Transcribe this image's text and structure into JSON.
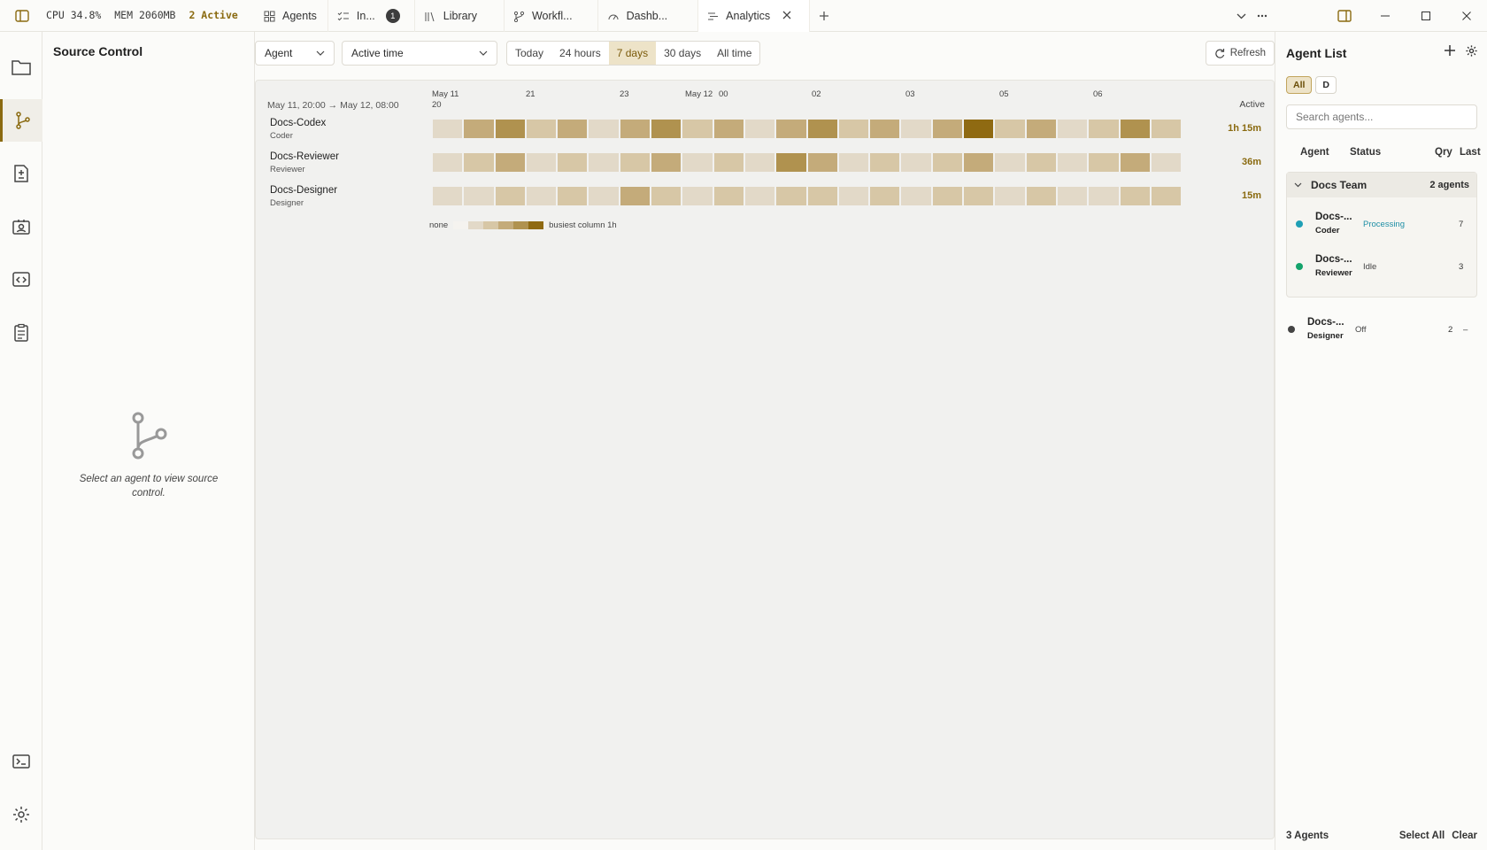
{
  "topbar": {
    "cpu": "CPU 34.8%",
    "mem": "MEM 2060MB",
    "active": "2 Active",
    "tabs": [
      {
        "label": "Agents",
        "icon": "grid-icon"
      },
      {
        "label": "In...",
        "icon": "checklist-icon",
        "badge": "1"
      },
      {
        "label": "Library",
        "icon": "library-icon"
      },
      {
        "label": "Workfl...",
        "icon": "workflow-icon"
      },
      {
        "label": "Dashb...",
        "icon": "gauge-icon"
      },
      {
        "label": "Analytics",
        "icon": "analytics-icon",
        "selected": true
      }
    ]
  },
  "source_control": {
    "title": "Source Control",
    "empty_text": "Select an agent to view source control."
  },
  "filters": {
    "group_by": "Agent",
    "metric": "Active time",
    "ranges": [
      "Today",
      "24 hours",
      "7 days",
      "30 days",
      "All time"
    ],
    "selected_range": "7 days",
    "refresh": "Refresh"
  },
  "heatmap": {
    "range_label": "May 11, 20:00 → May 12, 08:00",
    "date_labels": [
      "May 11",
      "May 12"
    ],
    "hour_labels": [
      "20",
      "21",
      "23",
      "00",
      "02",
      "03",
      "05",
      "06"
    ],
    "active_header": "Active",
    "agents": [
      {
        "name": "Docs-Codex",
        "role": "Coder",
        "active": "1h 15m",
        "levels": [
          1,
          3,
          4,
          2,
          3,
          1,
          3,
          4,
          2,
          3,
          1,
          3,
          4,
          2,
          3,
          1,
          3,
          5,
          2,
          3,
          1,
          2,
          4,
          2
        ]
      },
      {
        "name": "Docs-Reviewer",
        "role": "Reviewer",
        "active": "36m",
        "levels": [
          1,
          2,
          3,
          1,
          2,
          1,
          2,
          3,
          1,
          2,
          1,
          4,
          3,
          1,
          2,
          1,
          2,
          3,
          1,
          2,
          1,
          2,
          3,
          1
        ]
      },
      {
        "name": "Docs-Designer",
        "role": "Designer",
        "active": "15m",
        "levels": [
          1,
          1,
          2,
          1,
          2,
          1,
          3,
          2,
          1,
          2,
          1,
          2,
          2,
          1,
          2,
          1,
          2,
          2,
          1,
          2,
          1,
          1,
          2,
          2
        ]
      }
    ],
    "legend": {
      "none": "none",
      "busiest": "busiest column 1h"
    },
    "colors": [
      "#f5f3ef",
      "#e2d9c8",
      "#d7c7a6",
      "#c4ab7a",
      "#b0924f",
      "#8f6a12"
    ]
  },
  "agent_list": {
    "title": "Agent List",
    "filter_chips": [
      "All",
      "D"
    ],
    "search_placeholder": "Search agents...",
    "columns": {
      "agent": "Agent",
      "status": "Status",
      "qry": "Qry",
      "last": "Last"
    },
    "group": {
      "name": "Docs Team",
      "count": "2 agents"
    },
    "agents": [
      {
        "name": "Docs-...",
        "role": "Coder",
        "status": "Processing",
        "status_color": "#1f8fa6",
        "dot_color": "#1f9fb5",
        "qry": "7",
        "last": ""
      },
      {
        "name": "Docs-...",
        "role": "Reviewer",
        "status": "Idle",
        "status_color": "#444444",
        "dot_color": "#14a36b",
        "qry": "3",
        "last": ""
      },
      {
        "name": "Docs-...",
        "role": "Designer",
        "status": "Off",
        "status_color": "#444444",
        "dot_color": "#444444",
        "qry": "2",
        "last": "–"
      }
    ],
    "footer": {
      "count": "3 Agents",
      "select_all": "Select All",
      "clear": "Clear"
    }
  }
}
